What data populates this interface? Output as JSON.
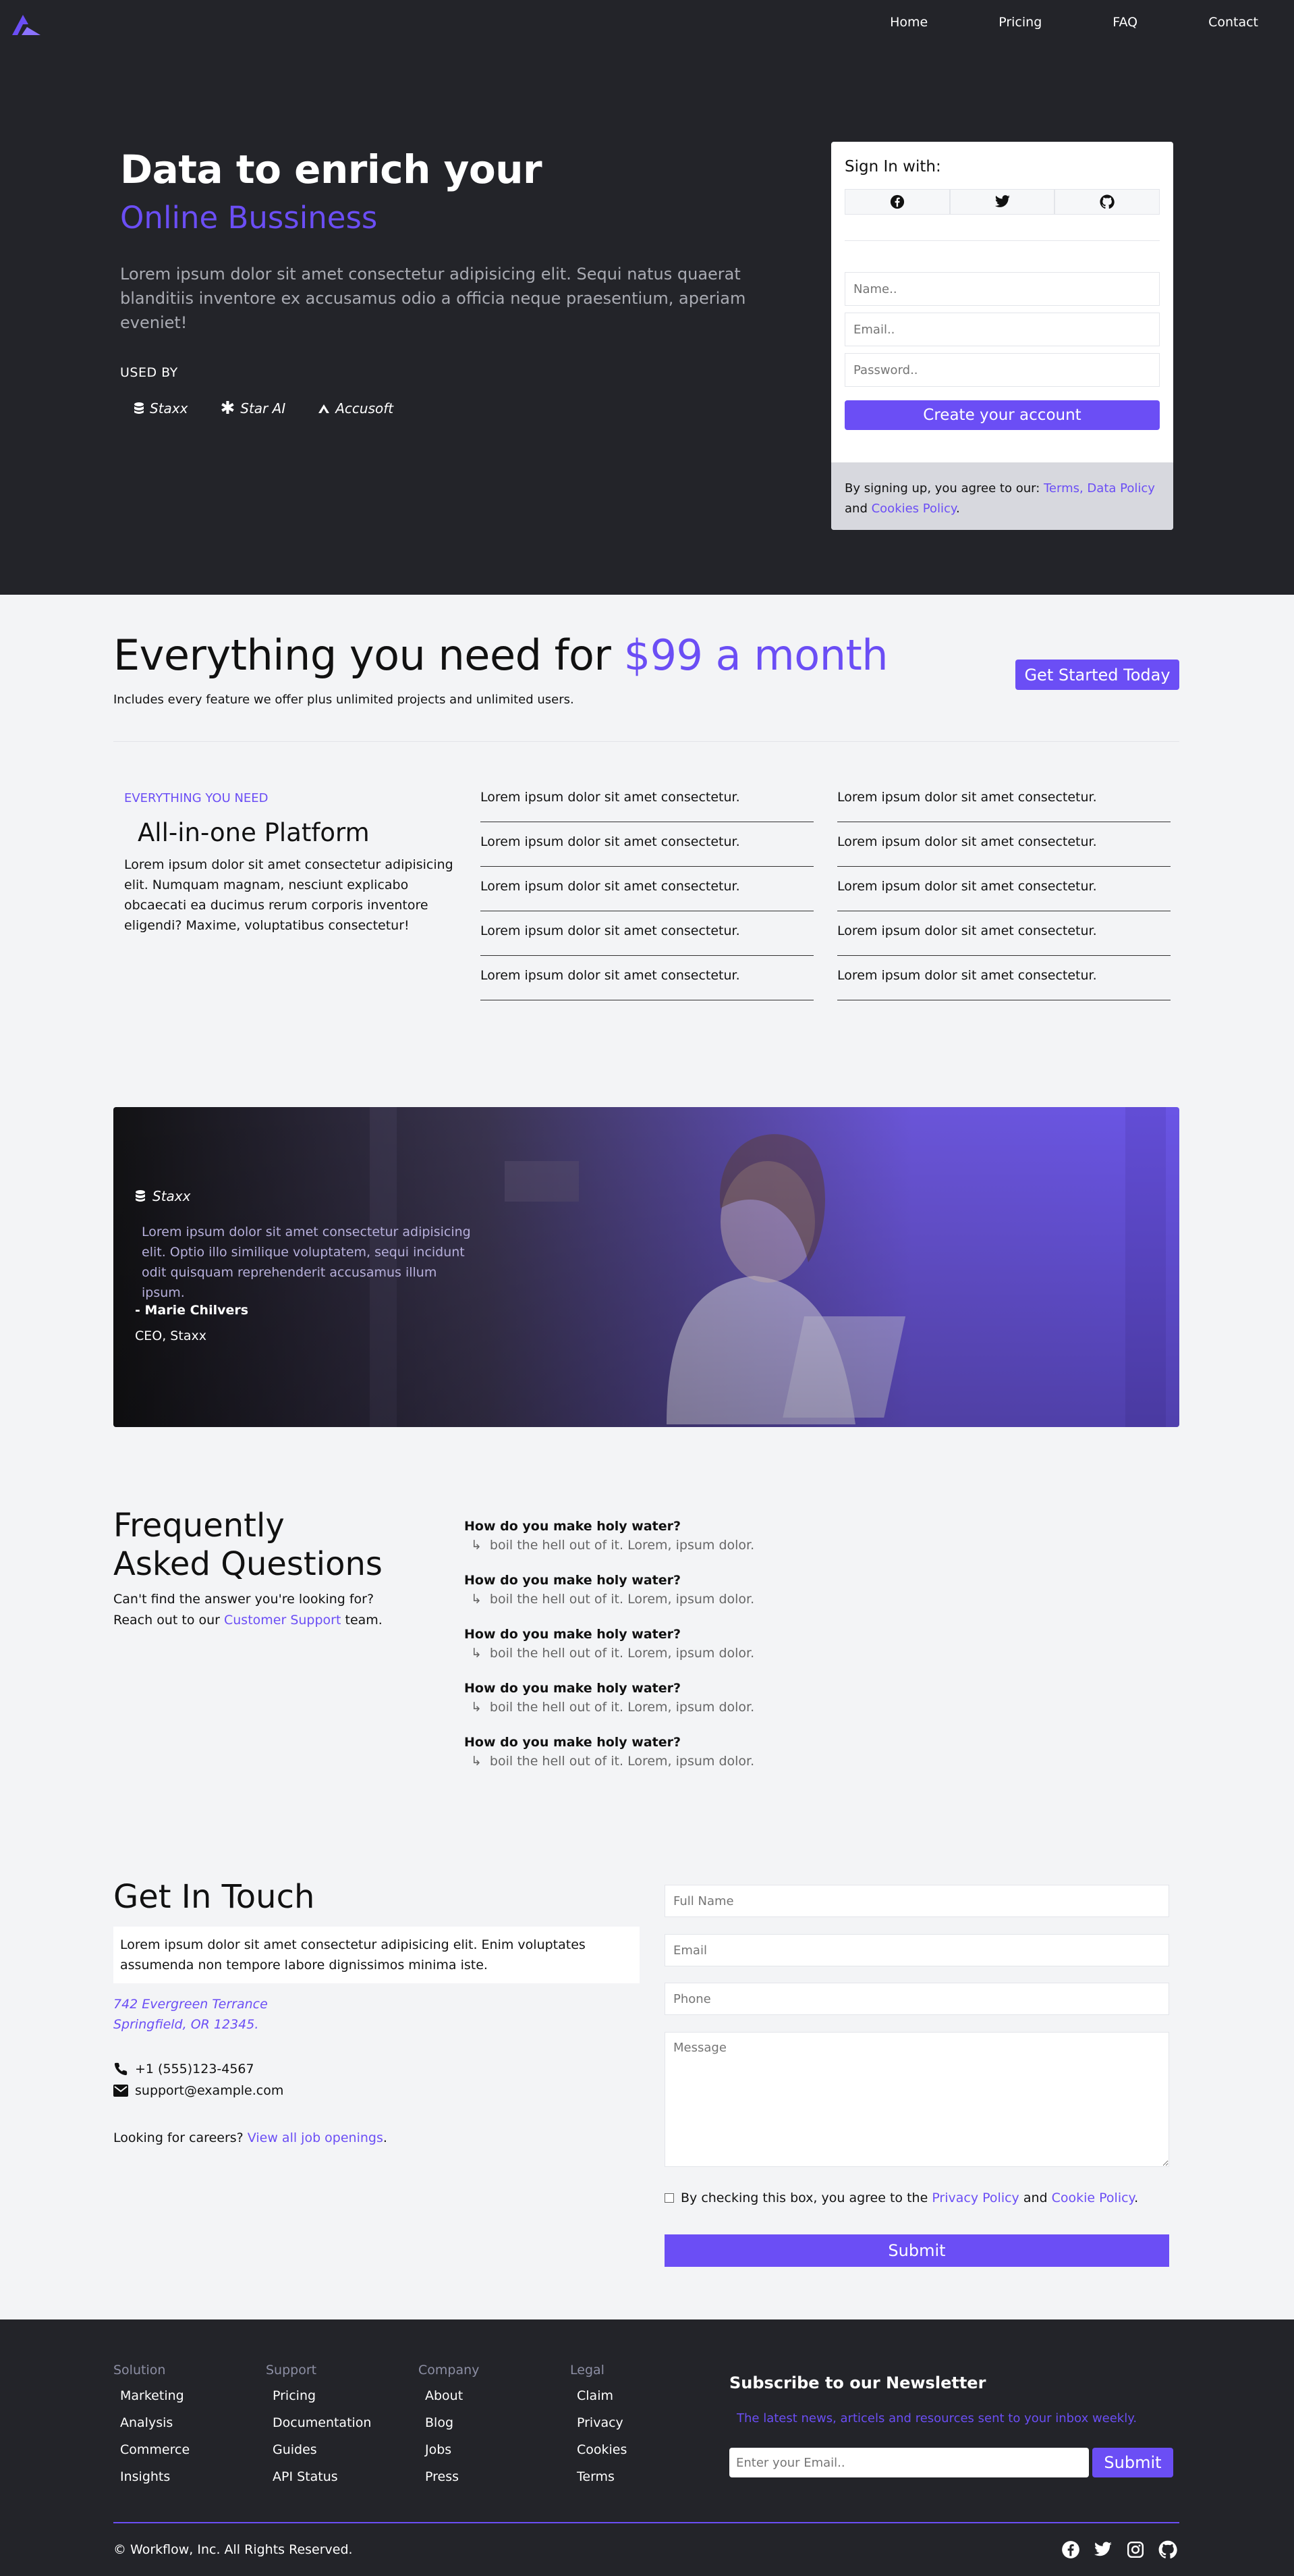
{
  "nav": {
    "links": [
      "Home",
      "Pricing",
      "FAQ",
      "Contact"
    ]
  },
  "hero": {
    "title": "Data to enrich your",
    "subtitle": "Online Bussiness",
    "description": "Lorem ipsum dolor sit amet consectetur adipisicing elit. Sequi natus quaerat blanditiis inventore ex accusamus odio a officia neque praesentium, aperiam eveniet!",
    "used_by": "USED BY",
    "brands": [
      "Staxx",
      "Star AI",
      "Accusoft"
    ]
  },
  "signin": {
    "title": "Sign In with:",
    "social_icons": [
      "facebook-icon",
      "twitter-icon",
      "github-icon"
    ],
    "name_placeholder": "Name..",
    "email_placeholder": "Email..",
    "password_placeholder": "Password..",
    "create_label": "Create your account",
    "terms_prefix": "By signing up, you agree to our: ",
    "terms_link": "Terms, Data Policy",
    "terms_and": "and ",
    "cookies_link": "Cookies Policy",
    "terms_end": "."
  },
  "pricing": {
    "heading": "Everything you need for ",
    "price": "$99 a month",
    "sub": "Includes every feature we offer plus unlimited projects and unlimited users.",
    "cta": "Get Started Today",
    "eyebrow": "EVERYTHING YOU NEED",
    "platform_title": "All-in-one Platform",
    "platform_desc": "Lorem ipsum dolor sit amet consectetur adipisicing elit. Numquam magnam, nesciunt explicabo obcaecati ea ducimus rerum corporis inventore eligendi? Maxime, voluptatibus consectetur!",
    "features_col1": [
      "Lorem ipsum dolor sit amet consectetur.",
      "Lorem ipsum dolor sit amet consectetur.",
      "Lorem ipsum dolor sit amet consectetur.",
      "Lorem ipsum dolor sit amet consectetur.",
      "Lorem ipsum dolor sit amet consectetur."
    ],
    "features_col2": [
      "Lorem ipsum dolor sit amet consectetur.",
      "Lorem ipsum dolor sit amet consectetur.",
      "Lorem ipsum dolor sit amet consectetur.",
      "Lorem ipsum dolor sit amet consectetur.",
      "Lorem ipsum dolor sit amet consectetur."
    ]
  },
  "testimonial": {
    "brand": "Staxx",
    "quote": "Lorem ipsum dolor sit amet consectetur adipisicing elit. Optio illo similique voluptatem, sequi incidunt odit quisquam reprehenderit accusamus illum ipsum.",
    "name": "- Marie Chilvers",
    "role": "CEO, Staxx"
  },
  "faq": {
    "title": "Frequently Asked Questions",
    "help_prefix": "Can't find the answer you're looking for? Reach out to our ",
    "help_link": "Customer Support",
    "help_suffix": " team.",
    "items": [
      {
        "q": "How do you make holy water?",
        "a": "boil the hell out of it. Lorem, ipsum dolor."
      },
      {
        "q": "How do you make holy water?",
        "a": "boil the hell out of it. Lorem, ipsum dolor."
      },
      {
        "q": "How do you make holy water?",
        "a": "boil the hell out of it. Lorem, ipsum dolor."
      },
      {
        "q": "How do you make holy water?",
        "a": "boil the hell out of it. Lorem, ipsum dolor."
      },
      {
        "q": "How do you make holy water?",
        "a": "boil the hell out of it. Lorem, ipsum dolor."
      }
    ]
  },
  "contact": {
    "title": "Get In Touch",
    "desc": "Lorem ipsum dolor sit amet consectetur adipisicing elit. Enim voluptates assumenda non tempore labore dignissimos minima iste.",
    "address_line1": "742 Evergreen Terrance",
    "address_line2": "Springfield, OR 12345.",
    "phone": "+1 (555)123-4567",
    "email": "support@example.com",
    "careers_prefix": "Looking for careers? ",
    "careers_link": "View all job openings",
    "careers_suffix": ".",
    "fullname_placeholder": "Full Name",
    "email_placeholder": "Email",
    "phone_placeholder": "Phone",
    "message_placeholder": "Message",
    "agree_prefix": "By checking this box, you agree to the ",
    "privacy_link": "Privacy Policy",
    "agree_and": " and ",
    "cookie_link": "Cookie Policy",
    "agree_end": ".",
    "submit": "Submit"
  },
  "footer": {
    "columns": [
      {
        "title": "Solution",
        "links": [
          "Marketing",
          "Analysis",
          "Commerce",
          "Insights"
        ]
      },
      {
        "title": "Support",
        "links": [
          "Pricing",
          "Documentation",
          "Guides",
          "API Status"
        ]
      },
      {
        "title": "Company",
        "links": [
          "About",
          "Blog",
          "Jobs",
          "Press"
        ]
      },
      {
        "title": "Legal",
        "links": [
          "Claim",
          "Privacy",
          "Cookies",
          "Terms"
        ]
      }
    ],
    "newsletter_title": "Subscribe to our Newsletter",
    "newsletter_desc": "The latest news, articels and resources sent to your inbox weekly.",
    "newsletter_placeholder": "Enter your Email..",
    "newsletter_button": "Submit",
    "copyright": "© Workflow, Inc. All Rights Reserved.",
    "social_icons": [
      "facebook-icon",
      "twitter-icon",
      "instagram-icon",
      "github-icon"
    ]
  },
  "colors": {
    "accent": "#6b4ef5",
    "dark": "#232429",
    "light": "#f3f4f6"
  }
}
